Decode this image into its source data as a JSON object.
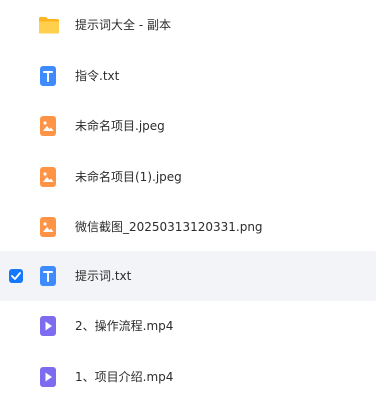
{
  "files": [
    {
      "name": "提示词大全 - 副本",
      "type": "folder",
      "icon": "folder-icon",
      "selected": false
    },
    {
      "name": "指令.txt",
      "type": "text",
      "icon": "text-file-icon",
      "selected": false
    },
    {
      "name": "未命名项目.jpeg",
      "type": "image",
      "icon": "image-file-icon",
      "selected": false
    },
    {
      "name": "未命名项目(1).jpeg",
      "type": "image",
      "icon": "image-file-icon",
      "selected": false
    },
    {
      "name": "微信截图_20250313120331.png",
      "type": "image",
      "icon": "image-file-icon",
      "selected": false
    },
    {
      "name": "提示词.txt",
      "type": "text",
      "icon": "text-file-icon",
      "selected": true
    },
    {
      "name": "2、操作流程.mp4",
      "type": "video",
      "icon": "video-file-icon",
      "selected": false
    },
    {
      "name": "1、项目介绍.mp4",
      "type": "video",
      "icon": "video-file-icon",
      "selected": false
    }
  ],
  "colors": {
    "selected_background": "#f3f4f7",
    "checkbox": "#1677ff",
    "folder": "#ffc53d",
    "text_file": "#3d8bfd",
    "image_file": "#ff9447",
    "video_file": "#7d6cf0"
  }
}
